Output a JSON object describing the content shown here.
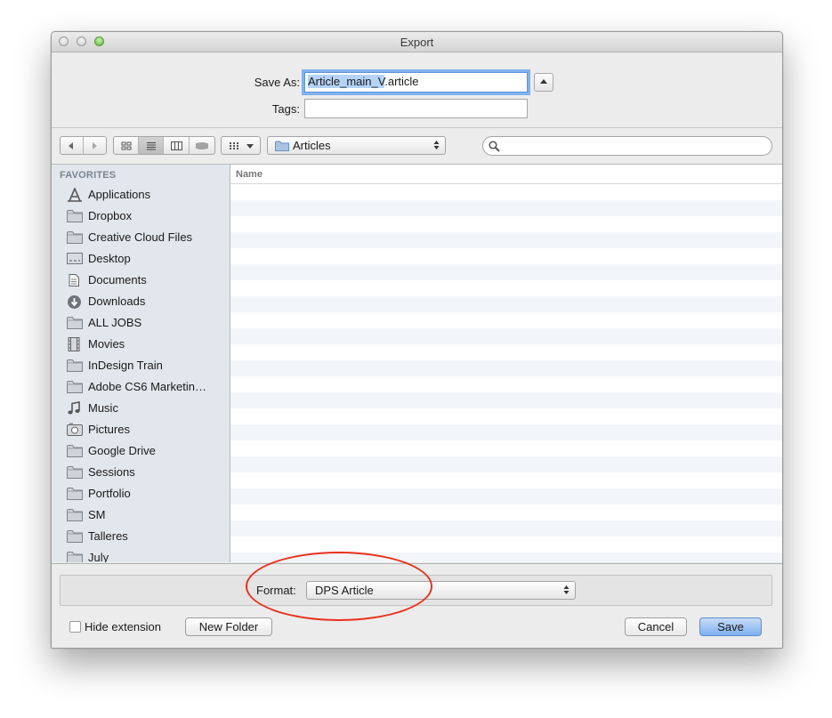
{
  "window": {
    "title": "Export"
  },
  "save_as": {
    "label": "Save As:",
    "selected_part": "Article_main_V",
    "rest": ".article"
  },
  "tags": {
    "label": "Tags:",
    "value": ""
  },
  "toolbar": {
    "location": "Articles",
    "search_placeholder": ""
  },
  "sidebar": {
    "heading": "FAVORITES",
    "items": [
      {
        "label": "Applications",
        "icon": "applications-icon"
      },
      {
        "label": "Dropbox",
        "icon": "folder-icon"
      },
      {
        "label": "Creative Cloud Files",
        "icon": "folder-icon"
      },
      {
        "label": "Desktop",
        "icon": "desktop-icon"
      },
      {
        "label": "Documents",
        "icon": "documents-icon"
      },
      {
        "label": "Downloads",
        "icon": "downloads-icon"
      },
      {
        "label": "ALL JOBS",
        "icon": "folder-icon"
      },
      {
        "label": "Movies",
        "icon": "movies-icon"
      },
      {
        "label": "InDesign Train",
        "icon": "folder-icon"
      },
      {
        "label": "Adobe CS6 Marketin…",
        "icon": "folder-icon"
      },
      {
        "label": "Music",
        "icon": "music-icon"
      },
      {
        "label": "Pictures",
        "icon": "pictures-icon"
      },
      {
        "label": "Google Drive",
        "icon": "folder-icon"
      },
      {
        "label": "Sessions",
        "icon": "folder-icon"
      },
      {
        "label": "Portfolio",
        "icon": "folder-icon"
      },
      {
        "label": "SM",
        "icon": "folder-icon"
      },
      {
        "label": "Talleres",
        "icon": "folder-icon"
      },
      {
        "label": "July",
        "icon": "folder-icon"
      }
    ]
  },
  "file_list": {
    "column_name": "Name"
  },
  "format": {
    "label": "Format:",
    "value": "DPS Article"
  },
  "footer": {
    "hide_extension": "Hide extension",
    "new_folder": "New Folder",
    "cancel": "Cancel",
    "save": "Save"
  },
  "colors": {
    "accent": "#7fb0ef",
    "annotation": "#e8321c"
  }
}
